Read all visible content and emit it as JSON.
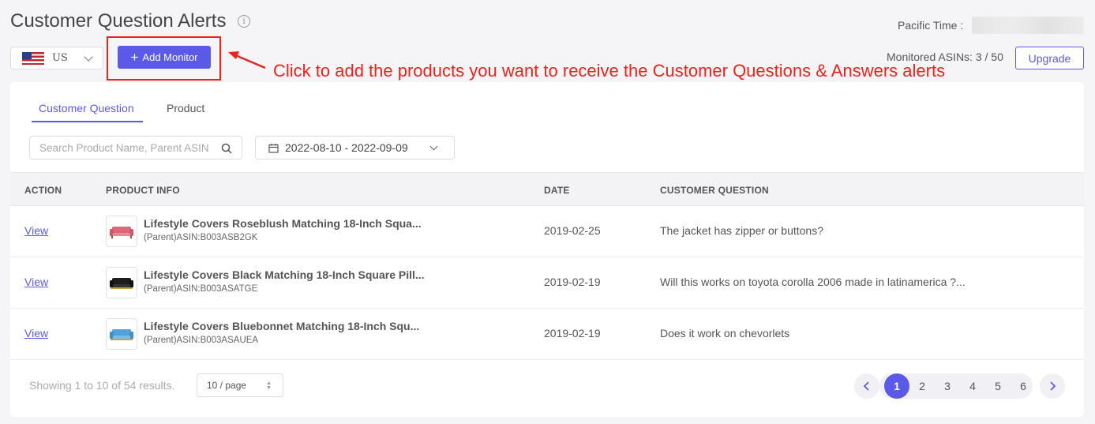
{
  "page": {
    "title": "Customer Question Alerts",
    "pacific_time_label": "Pacific Time :"
  },
  "country": {
    "selected": "US"
  },
  "toolbar": {
    "add_monitor_label": "Add Monitor",
    "monitored_asins": "Monitored ASINs: 3 / 50",
    "upgrade_label": "Upgrade"
  },
  "annotation": "Click to add the products you want to receive the Customer Questions & Answers alerts",
  "tabs": [
    {
      "label": "Customer Question",
      "active": true
    },
    {
      "label": "Product",
      "active": false
    }
  ],
  "filters": {
    "search_placeholder": "Search Product Name, Parent ASIN",
    "date_range": "2022-08-10 - 2022-09-09"
  },
  "table": {
    "headers": [
      "ACTION",
      "PRODUCT INFO",
      "DATE",
      "CUSTOMER QUESTION"
    ],
    "rows": [
      {
        "action": "View",
        "product_name": "Lifestyle Covers Roseblush Matching 18-Inch Squa...",
        "asin": "(Parent)ASIN:B003ASB2GK",
        "date": "2019-02-25",
        "question": "The jacket has zipper or buttons?",
        "thumb_color": "#e0677a"
      },
      {
        "action": "View",
        "product_name": "Lifestyle Covers Black Matching 18-Inch Square Pill...",
        "asin": "(Parent)ASIN:B003ASATGE",
        "date": "2019-02-19",
        "question": "Will this works on toyota corolla 2006 made in latinamerica ?...",
        "thumb_color": "#1d1d1d"
      },
      {
        "action": "View",
        "product_name": "Lifestyle Covers Bluebonnet Matching 18-Inch Squ...",
        "asin": "(Parent)ASIN:B003ASAUEA",
        "date": "2019-02-19",
        "question": "Does it work on chevorlets",
        "thumb_color": "#4fa3d8"
      }
    ]
  },
  "pagination": {
    "showing": "Showing 1 to 10 of 54 results.",
    "page_size": "10 / page",
    "pages": [
      "1",
      "2",
      "3",
      "4",
      "5",
      "6"
    ],
    "current": "1"
  },
  "colors": {
    "accent": "#5b5ae8",
    "annotation": "#e8251c"
  }
}
